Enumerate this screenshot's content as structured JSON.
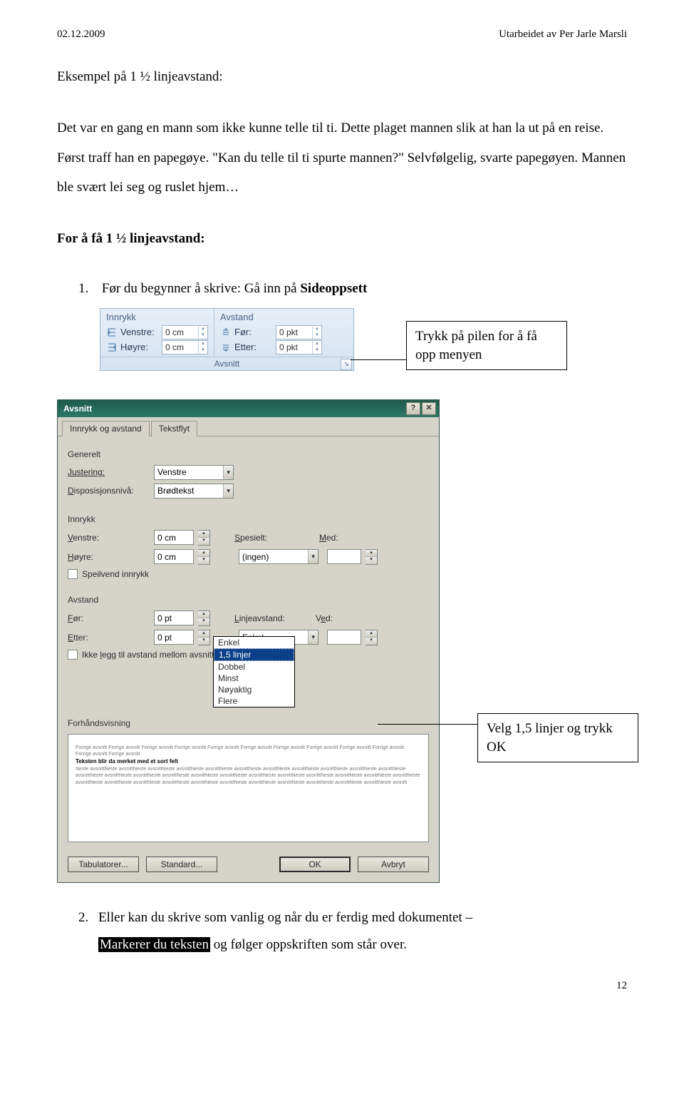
{
  "header": {
    "left": "02.12.2009",
    "right": "Utarbeidet av Per Jarle Marsli"
  },
  "intro_heading": "Eksempel på 1 ½ linjeavstand:",
  "intro_body": "Det var en gang en mann som ikke kunne telle til ti. Dette plaget mannen slik at han la ut på en reise. Først traff han en papegøye. \"Kan du telle til ti spurte mannen?\" Selvfølgelig, svarte papegøyen. Mannen ble svært lei seg og ruslet hjem…",
  "section2": "For å få 1 ½ linjeavstand:",
  "step1": {
    "num": "1.",
    "text_a": "Før du begynner å skrive: Gå inn på ",
    "text_b": "Sideoppsett"
  },
  "ribbon": {
    "col1_head": "Innrykk",
    "col2_head": "Avstand",
    "venstre": "Venstre:",
    "venstre_v": "0 cm",
    "hoyre": "Høyre:",
    "hoyre_v": "0 cm",
    "for": "Før:",
    "for_v": "0 pkt",
    "etter": "Etter:",
    "etter_v": "0 pkt",
    "group": "Avsnitt"
  },
  "callout1": "Trykk på pilen for å få opp menyen",
  "dialog": {
    "title": "Avsnitt",
    "tab1": "Innrykk og avstand",
    "tab2": "Tekstflyt",
    "generelt": "Generelt",
    "justering_l": "Justering:",
    "justering_v": "Venstre",
    "disp_l": "Disposisjonsnivå:",
    "disp_v": "Brødtekst",
    "innrykk": "Innrykk",
    "venstre_l": "Venstre:",
    "venstre_v": "0 cm",
    "hoyre_l": "Høyre:",
    "hoyre_v": "0 cm",
    "spesielt_l": "Spesielt:",
    "spesielt_v": "(ingen)",
    "med_l": "Med:",
    "speilvend": "Speilvend innrykk",
    "avstand": "Avstand",
    "for_l": "Før:",
    "for_v": "0 pt",
    "etter_l": "Etter:",
    "etter_v": "0 pt",
    "linje_l": "Linjeavstand:",
    "linje_v": "Enkel",
    "ved_l": "Ved:",
    "ikke_legg": "Ikke legg til avstand mellom avsnitt med",
    "options": [
      "Enkel",
      "1,5 linjer",
      "Dobbel",
      "Minst",
      "Nøyaktig",
      "Flere"
    ],
    "forhand": "Forhåndsvisning",
    "preview_grey1": "Forrige avsnitt Forrige avsnitt Forrige avsnitt Forrige avsnitt Forrige avsnitt Forrige avsnitt Forrige avsnitt Forrige avsnitt Forrige avsnitt Forrige avsnitt Forrige avsnitt Forrige avsnitt",
    "preview_bold": "Teksten blir da merket med et sort felt",
    "preview_grey2": "Neste avsnittNeste avsnittNeste avsnittNeste avsnittNeste avsnittNeste avsnittNeste avsnittNeste avsnittNeste avsnittNeste avsnittNeste avsnittNeste avsnittNeste avsnittNeste avsnittNeste avsnittNeste avsnittNeste avsnittNeste avsnittNeste avsnittNeste avsnittNeste avsnittNeste avsnittNeste avsnittNeste avsnittNeste avsnittNeste avsnittNeste avsnittNeste avsnittNeste avsnittNeste avsnittNeste avsnittNeste avsnittNeste avsnittNeste avsnittNeste avsnitt",
    "btn_tab": "Tabulatorer...",
    "btn_std": "Standard...",
    "btn_ok": "OK",
    "btn_avbryt": "Avbryt"
  },
  "callout2": "Velg 1,5 linjer og trykk OK",
  "step2": {
    "num": "2.",
    "text_a": "Eller kan du skrive som vanlig og når du er ferdig med dokumentet – ",
    "mark": "Markerer du teksten",
    "text_b": " og følger oppskriften som står over."
  },
  "pagenum": "12"
}
